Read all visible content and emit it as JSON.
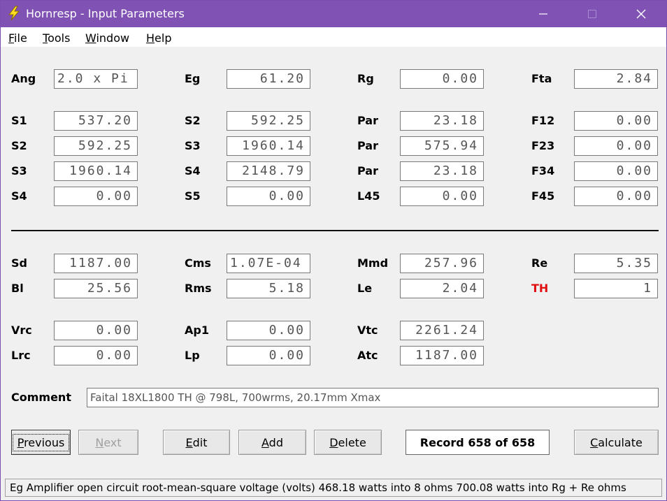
{
  "window": {
    "title": "Hornresp - Input Parameters",
    "accent_color": "#7f52b4",
    "icon": "lightning-icon"
  },
  "menu": [
    {
      "underline": "F",
      "rest": "ile"
    },
    {
      "underline": "T",
      "rest": "ools"
    },
    {
      "underline": "W",
      "rest": "indow"
    },
    {
      "underline": "H",
      "rest": "elp"
    }
  ],
  "params": {
    "ang": {
      "label": "Ang",
      "value": "2.0 x Pi"
    },
    "eg": {
      "label": "Eg",
      "value": "61.20"
    },
    "rg": {
      "label": "Rg",
      "value": "0.00"
    },
    "fta": {
      "label": "Fta",
      "value": "2.84"
    },
    "s1": {
      "label": "S1",
      "value": "537.20"
    },
    "s2_a": {
      "label": "S2",
      "value": "592.25"
    },
    "par1": {
      "label": "Par",
      "value": "23.18"
    },
    "f12": {
      "label": "F12",
      "value": "0.00"
    },
    "s2_b": {
      "label": "S2",
      "value": "592.25"
    },
    "s3_a": {
      "label": "S3",
      "value": "1960.14"
    },
    "par2": {
      "label": "Par",
      "value": "575.94"
    },
    "f23": {
      "label": "F23",
      "value": "0.00"
    },
    "s3_b": {
      "label": "S3",
      "value": "1960.14"
    },
    "s4_a": {
      "label": "S4",
      "value": "2148.79"
    },
    "par3": {
      "label": "Par",
      "value": "23.18"
    },
    "f34": {
      "label": "F34",
      "value": "0.00"
    },
    "s4_b": {
      "label": "S4",
      "value": "0.00"
    },
    "s5": {
      "label": "S5",
      "value": "0.00"
    },
    "l45": {
      "label": "L45",
      "value": "0.00"
    },
    "f45": {
      "label": "F45",
      "value": "0.00"
    },
    "sd": {
      "label": "Sd",
      "value": "1187.00"
    },
    "cms": {
      "label": "Cms",
      "value": "1.07E-04"
    },
    "mmd": {
      "label": "Mmd",
      "value": "257.96"
    },
    "re": {
      "label": "Re",
      "value": "5.35"
    },
    "bl": {
      "label": "Bl",
      "value": "25.56"
    },
    "rms": {
      "label": "Rms",
      "value": "5.18"
    },
    "le": {
      "label": "Le",
      "value": "2.04"
    },
    "th": {
      "label": "TH",
      "value": "1",
      "label_color": "#e01010"
    },
    "vrc": {
      "label": "Vrc",
      "value": "0.00"
    },
    "ap1": {
      "label": "Ap1",
      "value": "0.00"
    },
    "vtc": {
      "label": "Vtc",
      "value": "2261.24"
    },
    "lrc": {
      "label": "Lrc",
      "value": "0.00"
    },
    "lp": {
      "label": "Lp",
      "value": "0.00"
    },
    "atc": {
      "label": "Atc",
      "value": "1187.00"
    }
  },
  "comment": {
    "label": "Comment",
    "value": "Faital 18XL1800 TH @ 798L, 700wrms, 20.17mm Xmax"
  },
  "buttons": {
    "previous": {
      "underline": "P",
      "rest": "revious"
    },
    "next": {
      "underline": "N",
      "rest": "ext"
    },
    "edit": {
      "underline": "E",
      "rest": "dit"
    },
    "add": {
      "underline": "A",
      "rest": "dd"
    },
    "delete": {
      "underline": "D",
      "rest": "elete"
    },
    "calculate": {
      "underline": "C",
      "rest": "alculate"
    }
  },
  "record": "Record 658 of 658",
  "status": "Eg  Amplifier open circuit root-mean-square voltage  (volts)   468.18 watts into 8 ohms   700.08 watts into Rg + Re ohms"
}
